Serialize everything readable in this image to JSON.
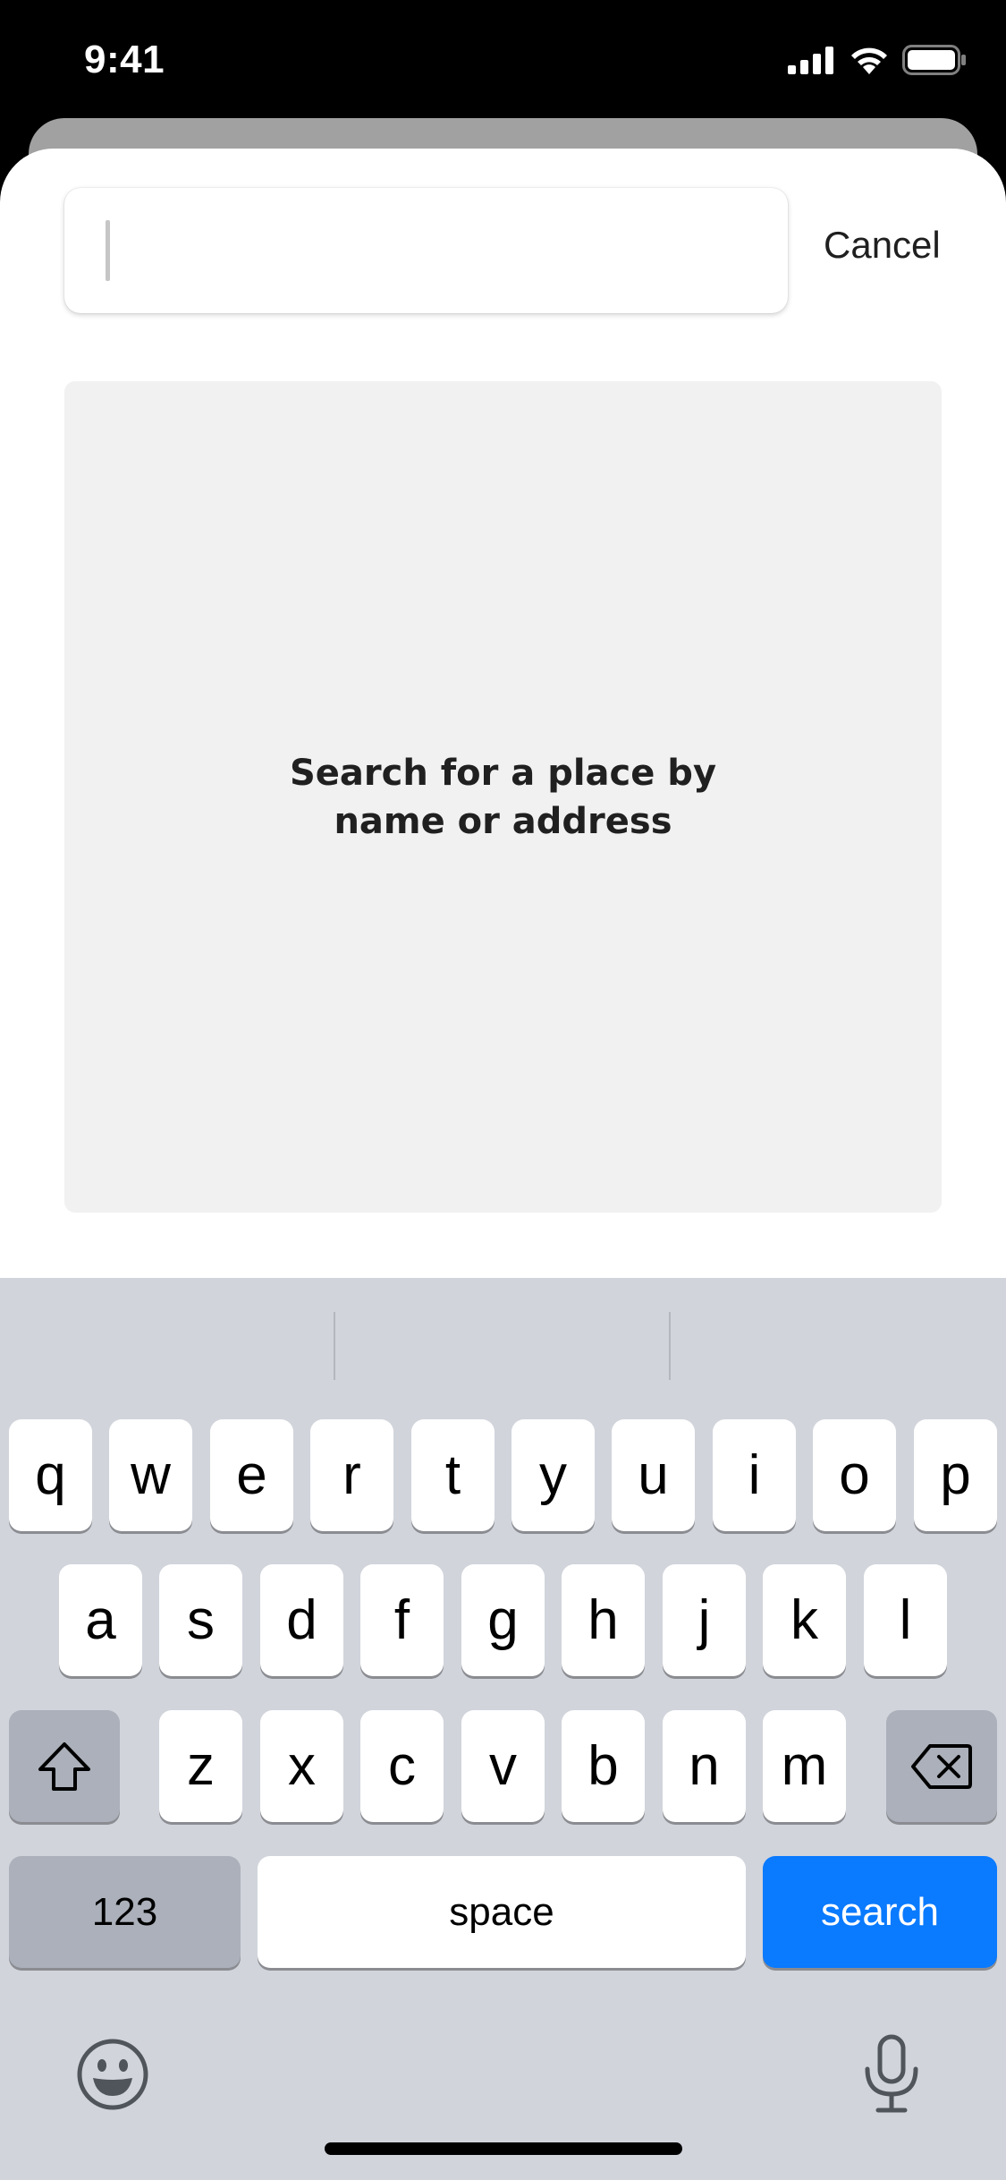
{
  "status_bar": {
    "time": "9:41"
  },
  "search": {
    "value": "",
    "placeholder": ""
  },
  "header": {
    "cancel_label": "Cancel"
  },
  "empty_state": {
    "message": "Search for a place by name or address"
  },
  "keyboard": {
    "row1": [
      "q",
      "w",
      "e",
      "r",
      "t",
      "y",
      "u",
      "i",
      "o",
      "p"
    ],
    "row2": [
      "a",
      "s",
      "d",
      "f",
      "g",
      "h",
      "j",
      "k",
      "l"
    ],
    "row3": [
      "z",
      "x",
      "c",
      "v",
      "b",
      "n",
      "m"
    ],
    "numbers_label": "123",
    "space_label": "space",
    "action_label": "search",
    "action_color": "#0a7aff"
  },
  "icons": {
    "signal": "cellular-signal-icon",
    "wifi": "wifi-icon",
    "battery": "battery-icon",
    "shift": "shift-icon",
    "delete": "delete-icon",
    "emoji": "emoji-icon",
    "mic": "microphone-icon"
  }
}
